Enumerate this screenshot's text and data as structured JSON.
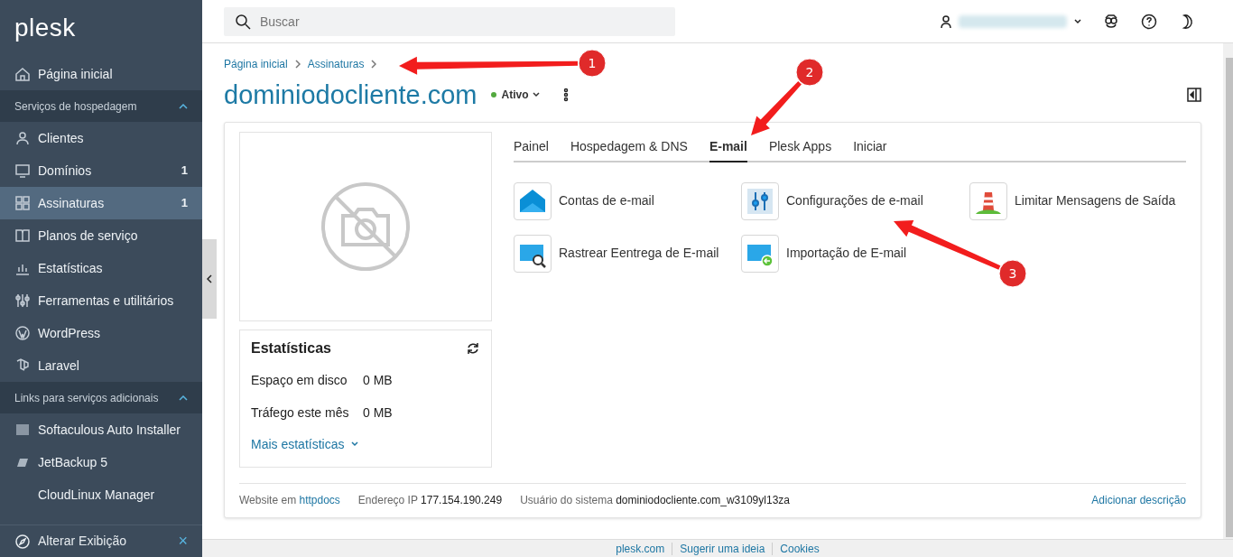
{
  "sidebar": {
    "logo": "plesk",
    "items": [
      {
        "kind": "link",
        "label": "Página inicial",
        "selected": false
      },
      {
        "kind": "section",
        "label": "Serviços de hospedagem",
        "expanded": true
      },
      {
        "kind": "link",
        "label": "Clientes",
        "selected": false
      },
      {
        "kind": "link",
        "label": "Domínios",
        "count": "1",
        "selected": false
      },
      {
        "kind": "link",
        "label": "Assinaturas",
        "count": "1",
        "selected": true
      },
      {
        "kind": "link",
        "label": "Planos de serviço",
        "selected": false
      },
      {
        "kind": "link",
        "label": "Estatísticas",
        "selected": false
      },
      {
        "kind": "link",
        "label": "Ferramentas e utilitários",
        "selected": false
      },
      {
        "kind": "link",
        "label": "WordPress",
        "selected": false
      },
      {
        "kind": "link",
        "label": "Laravel",
        "selected": false
      },
      {
        "kind": "section",
        "label": "Links para serviços adicionais",
        "expanded": true
      },
      {
        "kind": "link",
        "label": "Softaculous Auto Installer",
        "selected": false
      },
      {
        "kind": "link",
        "label": "JetBackup 5",
        "selected": false
      },
      {
        "kind": "link",
        "label": "CloudLinux Manager",
        "selected": false
      }
    ],
    "bottom": {
      "label": "Alterar Exibição",
      "close": "×"
    }
  },
  "header": {
    "search": {
      "placeholder": "Buscar"
    }
  },
  "breadcrumbs": [
    "Página inicial",
    "Assinaturas"
  ],
  "subscription": {
    "title": "dominiodocliente.com",
    "status": "Ativo",
    "active": true
  },
  "tabs": [
    {
      "label": "Painel",
      "selected": false
    },
    {
      "label": "Hospedagem & DNS",
      "selected": false
    },
    {
      "label": "E-mail",
      "selected": true
    },
    {
      "label": "Plesk Apps",
      "selected": false
    },
    {
      "label": "Iniciar",
      "selected": false
    }
  ],
  "tools": [
    {
      "label": "Contas de e-mail"
    },
    {
      "label": "Configurações de e-mail"
    },
    {
      "label": "Limitar Mensagens de Saída"
    },
    {
      "label": "Rastrear Eentrega de E-mail"
    },
    {
      "label": "Importação de E-mail"
    }
  ],
  "stats": {
    "title": "Estatísticas",
    "rows": [
      {
        "label": "Espaço em disco",
        "value": "0 MB"
      },
      {
        "label": "Tráfego este mês",
        "value": "0 MB"
      }
    ],
    "more": "Mais estatísticas"
  },
  "info": [
    {
      "label": "Website em",
      "value": "httpdocs",
      "kind": "link"
    },
    {
      "label": "Endereço IP",
      "value": "177.154.190.249",
      "kind": "text"
    },
    {
      "label": "Usuário do sistema",
      "value": "dominiodocliente.com_w3109yl13za",
      "kind": "text"
    }
  ],
  "add_description": "Adicionar descrição",
  "footer_links": [
    "plesk.com",
    "Sugerir uma ideia",
    "Cookies"
  ],
  "annotations": [
    {
      "label": "1"
    },
    {
      "label": "2"
    },
    {
      "label": "3"
    }
  ]
}
